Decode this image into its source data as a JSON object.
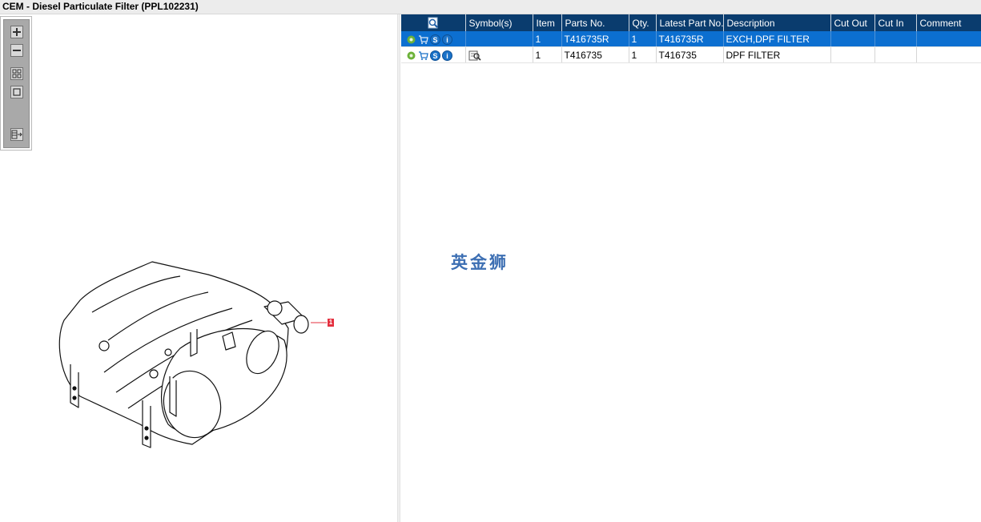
{
  "window": {
    "title": "CEM - Diesel Particulate Filter (PPL102231)"
  },
  "toolbar": {
    "buttons": [
      {
        "name": "zoom-in",
        "icon": "plus-icon"
      },
      {
        "name": "zoom-out",
        "icon": "minus-icon"
      },
      {
        "name": "fit-all",
        "icon": "grid-icon"
      },
      {
        "name": "fit-window",
        "icon": "square-icon"
      },
      {
        "name": "export",
        "icon": "export-icon"
      }
    ]
  },
  "drawing": {
    "callout": "1"
  },
  "grid": {
    "columns": {
      "icons": "",
      "symbols": "Symbol(s)",
      "item": "Item",
      "parts_no": "Parts No.",
      "qty": "Qty.",
      "latest_part_no": "Latest Part No.",
      "description": "Description",
      "cut_out": "Cut Out",
      "cut_in": "Cut In",
      "comment": "Comment"
    },
    "rows": [
      {
        "item": "1",
        "parts_no": "T416735R",
        "qty": "1",
        "latest_part_no": "T416735R",
        "description": "EXCH,DPF FILTER",
        "cut_out": "",
        "cut_in": "",
        "comment": "",
        "selected": true
      },
      {
        "item": "1",
        "parts_no": "T416735",
        "qty": "1",
        "latest_part_no": "T416735",
        "description": "DPF FILTER",
        "cut_out": "",
        "cut_in": "",
        "comment": "",
        "selected": false
      }
    ]
  },
  "watermark": {
    "text": "英金狮"
  },
  "colors": {
    "header": "#0a3c6e",
    "selection": "#0c6fd0",
    "callout": "#e4303f"
  }
}
